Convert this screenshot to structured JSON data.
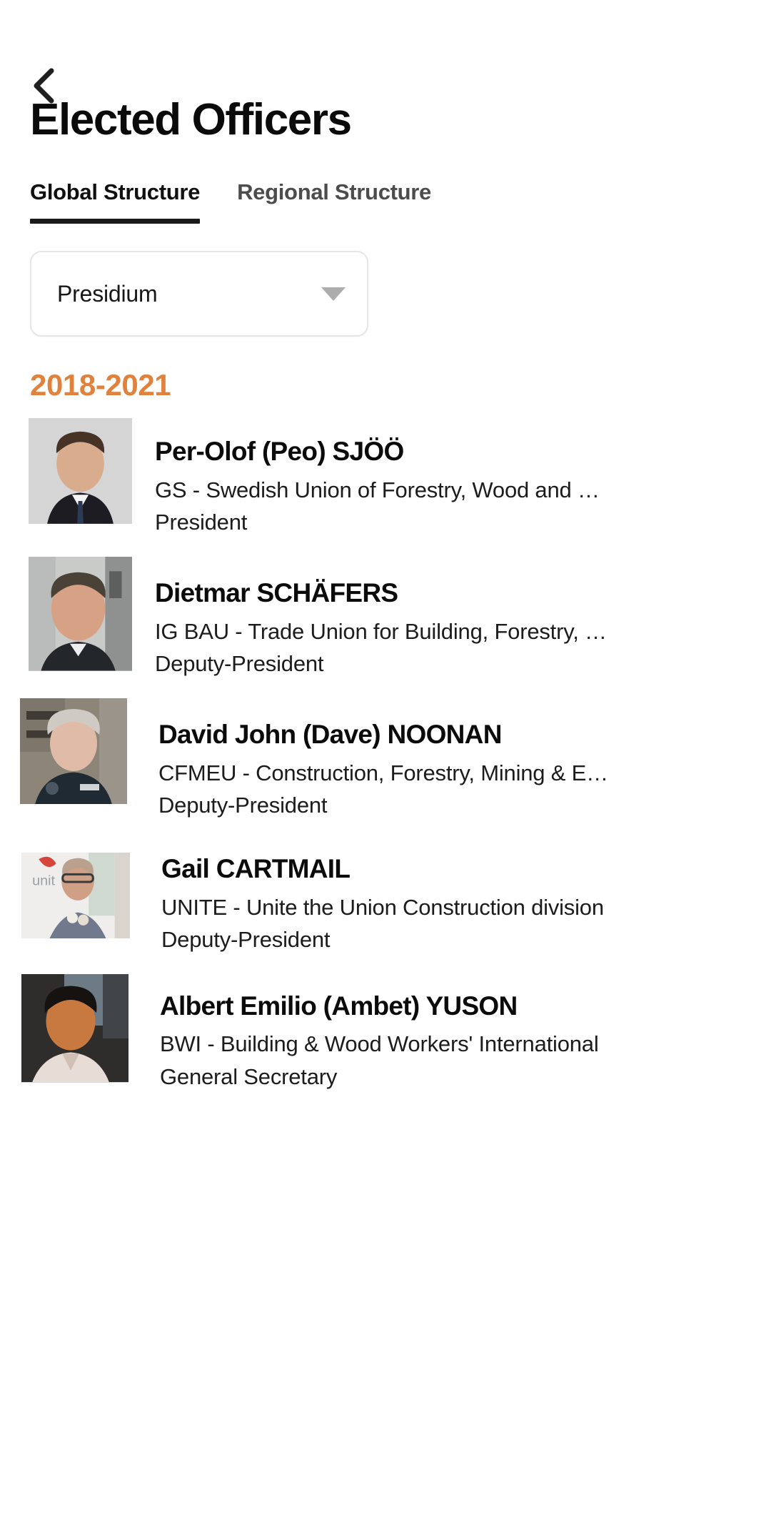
{
  "nav": {
    "back_icon": "chevron-left-icon"
  },
  "header": {
    "title": "Elected Officers"
  },
  "tabs": [
    {
      "label": "Global Structure",
      "active": true
    },
    {
      "label": "Regional Structure",
      "active": false
    }
  ],
  "filter": {
    "selected": "Presidium",
    "caret_icon": "chevron-down-icon"
  },
  "section": {
    "term": "2018-2021",
    "term_color": "#e0813c"
  },
  "officers": [
    {
      "name": "Per-Olof (Peo) SJÖÖ",
      "organisation": "GS - Swedish Union of Forestry, Wood and …",
      "role": "President",
      "photo": "portrait-per-olof-sjoo"
    },
    {
      "name": "Dietmar SCHÄFERS",
      "organisation": "IG BAU - Trade Union for Building, Forestry, …",
      "role": "Deputy-President",
      "photo": "portrait-dietmar-schaefers"
    },
    {
      "name": "David John (Dave) NOONAN",
      "organisation": "CFMEU - Construction, Forestry, Mining & E…",
      "role": "Deputy-President",
      "photo": "portrait-david-noonan"
    },
    {
      "name": "Gail CARTMAIL",
      "organisation": "UNITE - Unite the Union Construction division",
      "role": "Deputy-President",
      "photo": "portrait-gail-cartmail"
    },
    {
      "name": "Albert Emilio (Ambet) YUSON",
      "organisation": "BWI - Building & Wood Workers' International",
      "role": "General Secretary",
      "photo": "portrait-ambet-yuson"
    }
  ]
}
